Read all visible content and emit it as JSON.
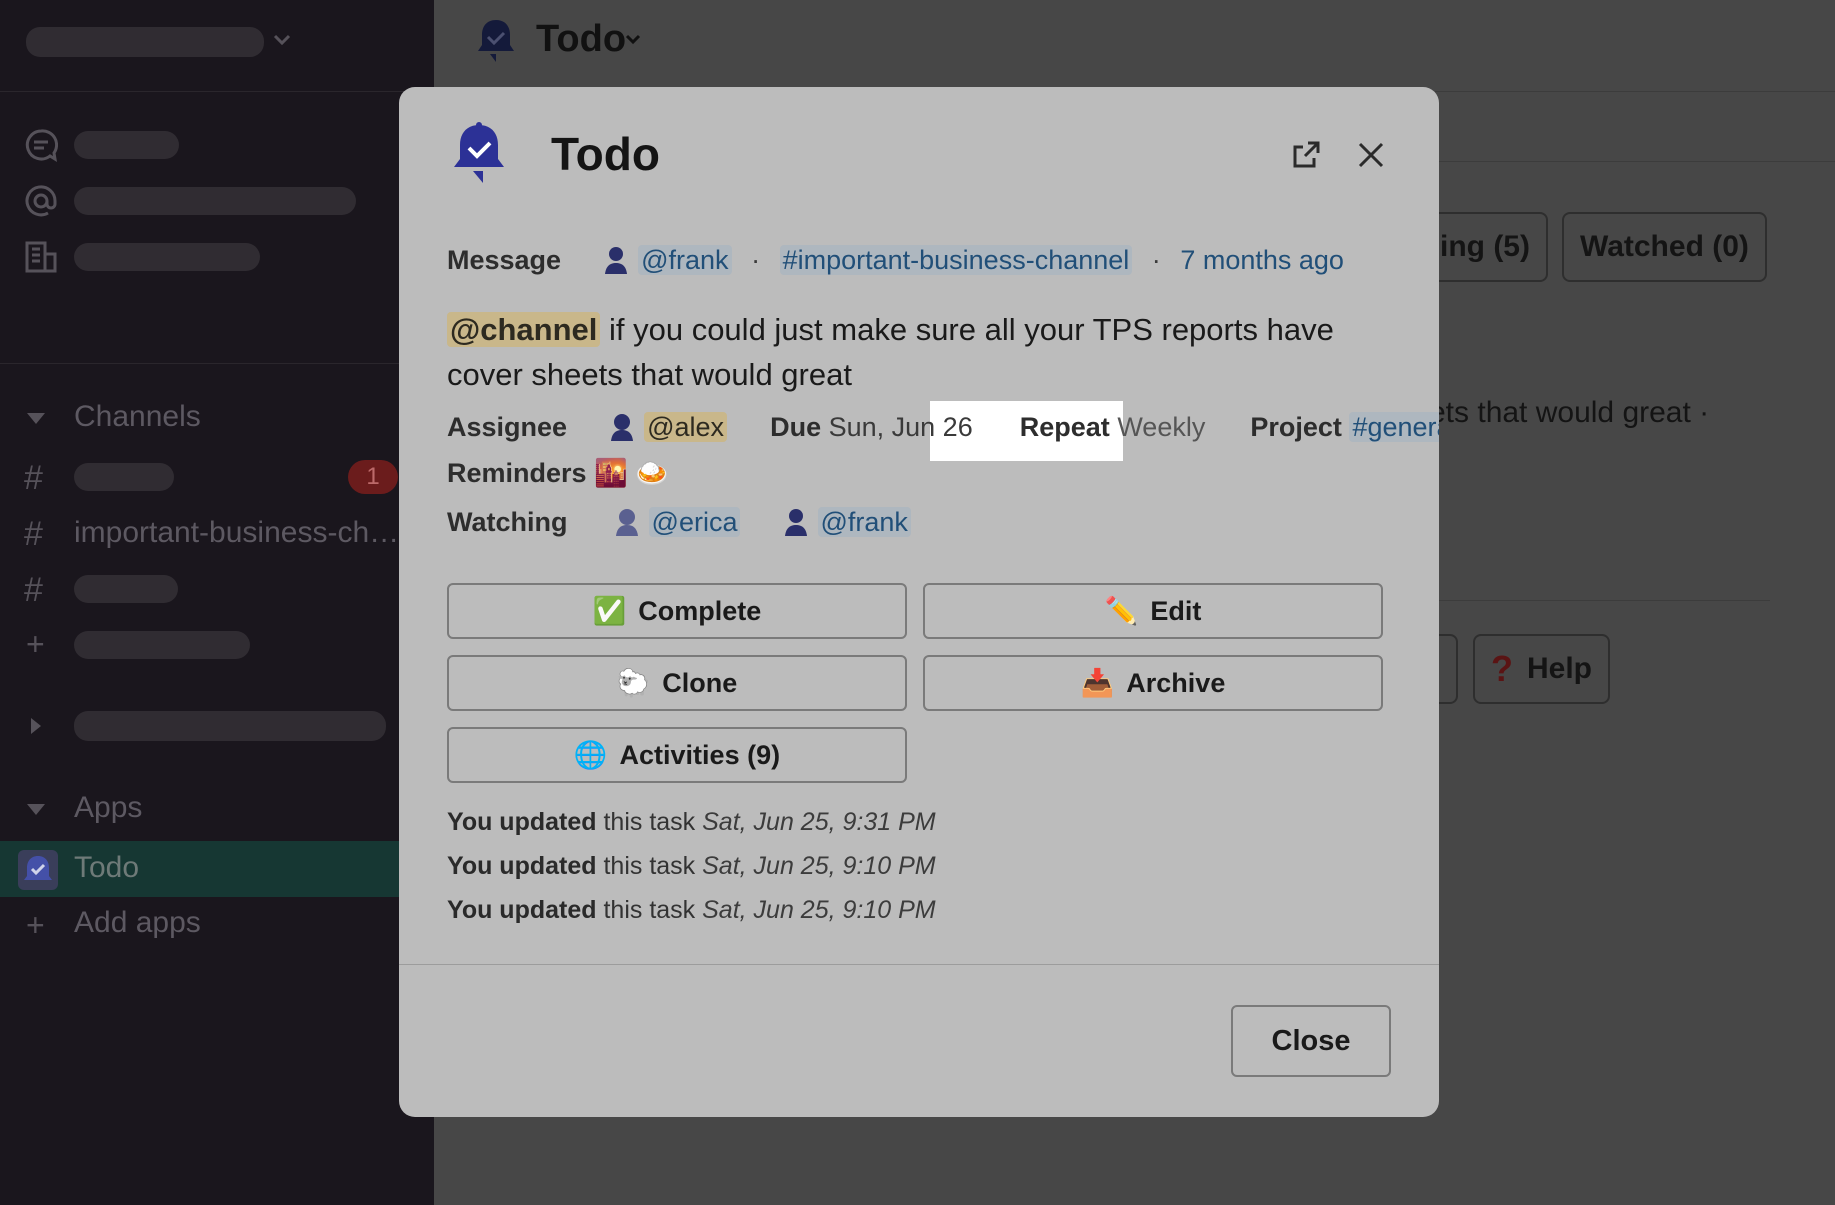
{
  "sidebar": {
    "sections": {
      "channels": "Channels",
      "apps": "Apps"
    },
    "channel_item": "important-business-ch…",
    "unread_badge": "1",
    "apps_items": {
      "todo": "Todo",
      "add_apps": "Add apps"
    }
  },
  "main": {
    "title": "Todo",
    "tabs": {
      "partial": "ing (5)",
      "watched": "Watched (0)"
    },
    "bg_snippet": "ets that would great ·",
    "help_label": "Help"
  },
  "modal": {
    "title": "Todo",
    "message_label": "Message",
    "author": "@frank",
    "channel": "#important-business-channel",
    "time_ago": "7 months ago",
    "mention_channel": "@channel",
    "body": " if you could just make sure all your TPS reports have cover sheets that would great",
    "assignee_label": "Assignee",
    "assignee": "@alex",
    "due_label": "Due",
    "due_value": "Sun, Jun 26",
    "repeat_label": "Repeat",
    "repeat_value": "Weekly",
    "project_label": "Project",
    "project_value": "#general",
    "reminders_label": "Reminders",
    "reminder_emojis": "🌇 🍛",
    "watching_label": "Watching",
    "watchers": [
      "@erica",
      "@frank"
    ],
    "buttons": {
      "complete": "Complete",
      "complete_icon": "✅",
      "edit": "Edit",
      "edit_icon": "✏️",
      "clone": "Clone",
      "clone_icon": "🐑",
      "archive": "Archive",
      "archive_icon": "📥",
      "activities": "Activities (9)",
      "activities_icon": "🌐"
    },
    "activity_log": [
      {
        "who": "You updated",
        "what": " this task ",
        "when": "Sat, Jun 25, 9:31 PM"
      },
      {
        "who": "You updated",
        "what": " this task ",
        "when": "Sat, Jun 25, 9:10 PM"
      },
      {
        "who": "You updated",
        "what": " this task ",
        "when": "Sat, Jun 25, 9:10 PM"
      }
    ],
    "close_button": "Close"
  }
}
